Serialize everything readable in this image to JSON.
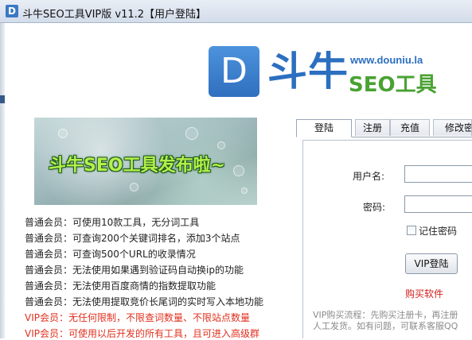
{
  "window": {
    "icon_letter": "D",
    "title": "斗牛SEO工具VIP版 v11.2【用户登陆】"
  },
  "logo": {
    "letter": "D",
    "brand": "斗牛",
    "url": "www.douniu.la",
    "subtitle": "SEO工具"
  },
  "banner": {
    "text": "斗牛SEO工具发布啦~"
  },
  "members": [
    {
      "text": "普通会员：可使用10款工具，无分词工具",
      "color": "#222222"
    },
    {
      "text": "普通会员：可查询200个关键词排名，添加3个站点",
      "color": "#222222"
    },
    {
      "text": "普通会员：可查询500个URL的收录情况",
      "color": "#222222"
    },
    {
      "text": "普通会员：无法使用如果遇到验证码自动换ip的功能",
      "color": "#222222"
    },
    {
      "text": "普通会员：无法使用百度商情的指数提取功能",
      "color": "#222222"
    },
    {
      "text": "普通会员：无法使用提取竞价长尾词的实时写入本地功能",
      "color": "#222222"
    },
    {
      "text": "VIP会员：无任何限制，不限查词数量、不限站点数量",
      "color": "#e0301e"
    },
    {
      "text": "VIP会员：可使用以后开发的所有工具，且可进入高级群",
      "color": "#e0301e"
    }
  ],
  "tabs": [
    {
      "label": "登陆",
      "active": true
    },
    {
      "label": "注册",
      "active": false
    },
    {
      "label": "充值",
      "active": false
    },
    {
      "label": "修改密",
      "active": false
    }
  ],
  "login": {
    "username_label": "用户名:",
    "username_value": "",
    "password_label": "密码:",
    "password_value": "",
    "remember_label": "记住密码",
    "remember_checked": false,
    "submit_label": "VIP登陆",
    "buy_label": "购买软件",
    "vip_note_line1": "VIP购买流程：先购买注册卡，再注册",
    "vip_note_line2": "人工发货。如有问题，可联系客服QQ"
  },
  "colors": {
    "brand_blue": "#2c6fc0",
    "brand_green": "#49a232",
    "vip_red": "#e0301e"
  }
}
